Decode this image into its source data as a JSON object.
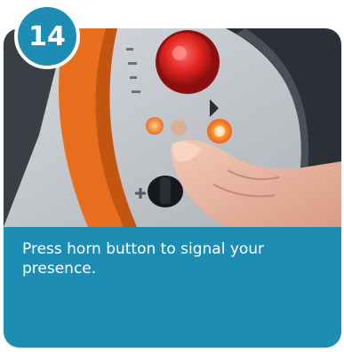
{
  "step": {
    "number": "14",
    "instruction": "Press horn button to signal your presence.",
    "photo_icon": "hand-pressing-horn-button-photo"
  },
  "colors": {
    "card_background": "#1e8db4",
    "badge_border": "#ffffff",
    "caption_text": "#ffffff"
  }
}
